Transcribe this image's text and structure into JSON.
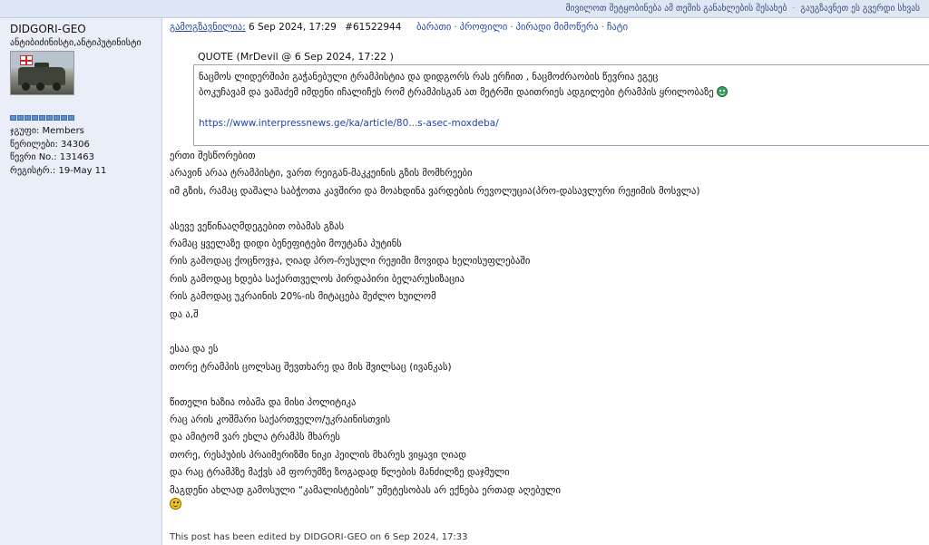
{
  "topbar": {
    "link1": "მივილოთ შეტყობინება ამ თემის განახლების შესახებ",
    "link2": "გაუგზავნეთ ეს გვერდი სხვას"
  },
  "user": {
    "name": "DIDGORI-GEO",
    "title": "ანტიბიძინისტი,ანტიპუტინისტი",
    "group": "ჯგუფი: Members",
    "posts": "წერილები: 34306",
    "member_no": "წევრი No.: 131463",
    "registered": "რეგისტრ.: 19-May 11",
    "rank_pips": 9
  },
  "post_header": {
    "sent_label": "გამოგზავნილია:",
    "datetime": "6 Sep 2024, 17:29",
    "post_id": "#61522944",
    "links": [
      "ბარათი",
      "პროფილი",
      "პირადი მიმოწერა",
      "ჩატი"
    ]
  },
  "quote": {
    "label": "QUOTE (MrDevil @ 6 Sep 2024, 17:22 )",
    "line1": "ნაცმოს ლიდერშიპი გაჭანებული ტრამპისტია და დიდგორს რას ერჩით , ნაცმოძრაობის წევრია ეგეც",
    "line2": "ბოკუჩავამ და ვაშაძემ იმდენი იჩალიჩეს რომ ტრამპისგან ათ მეტრში დაითრიეს ადგილები ტრამპის  ყრილობაზე",
    "url": "https://www.interpressnews.ge/ka/article/80...s-asec-moxdeba/"
  },
  "post_paragraphs": [
    [
      "ერთი შესწორებით",
      "არავინ არაა ტრამპისტი, ვართ რეიგან-მაკკეინის გზის მომხრეები",
      "იმ გზის, რამაც დაშალა საბჭოთა კავშირი და მოახდინა ვარდების რევოლუცია(პრო-დასავლური რეჟიმის მოსვლა)"
    ],
    [
      "ასევე ვეწინააღმდეგებით ობამას გზას",
      "რამაც ყველაზე დიდი ბენეფიტები მოუტანა პუტინს",
      "რის გამოდაც ქოცნოვჯა, ღიად პრო-რუსული რეჟიმი მოვიდა ხელისუფლებაში",
      "რის გამოდაც ხდება საქართველოს პირდაპირი ბელარუსიზაცია",
      "რის გამოდაც უკრაინის 20%-ის მიტაცება შეძლო ხუილომ",
      "და ა,შ"
    ],
    [
      "ესაა და ეს",
      "თორე ტრამპის ცოლსაც შევთხარე და მის შვილსაც (ივანკას)"
    ],
    [
      "წითელი ხაზია ობამა და მისი პოლიტიკა",
      "რაც არის კოშმარი საქართველო/უკრაინისთვის",
      "და ამიტომ ვარ ეხლა ტრამპს მხარეს",
      "თორე, რესპუბის პრაიმერიზში ნიკი ჰეილის მხარეს ვიყავი ღიად",
      "და რაც ტრამპზე მაქვს ამ ფორუმზე ზოგადად წლების მანძილზე დაჯმული",
      "მაგდენი ახლად გამოსული “კამალისტების” უმეტესობას არ ექნება ერთად აღებული"
    ]
  ],
  "edited_note": "This post has been edited by DIDGORI-GEO on 6 Sep 2024, 17:33"
}
